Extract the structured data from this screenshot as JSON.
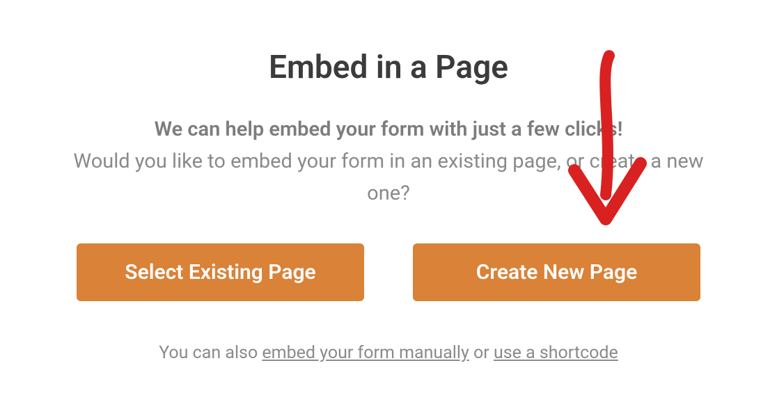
{
  "modal": {
    "title": "Embed in a Page",
    "lead": "We can help embed your form with just a few clicks!",
    "sub": "Would you like to embed your form in an existing page, or create a new one?",
    "buttons": {
      "select_existing": "Select Existing Page",
      "create_new": "Create New Page"
    },
    "footer": {
      "prefix": "You can also ",
      "link_embed": "embed your form manually",
      "middle": " or ",
      "link_shortcode": "use a shortcode"
    }
  },
  "annotation": {
    "arrow_color": "#d92121",
    "target": "create-new-page-button"
  }
}
